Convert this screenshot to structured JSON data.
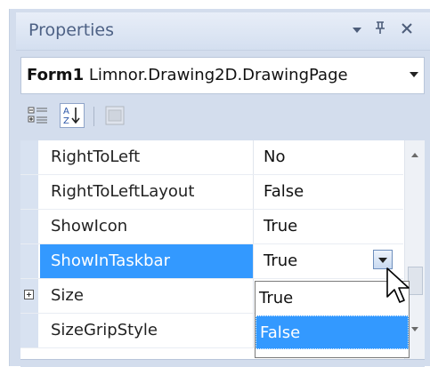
{
  "window": {
    "title": "Properties"
  },
  "selector": {
    "object_name": "Form1",
    "object_type": "Limnor.Drawing2D.DrawingPage"
  },
  "toolbar": {
    "categorized_icon": "categorized-icon",
    "alphabetical_icon": "alphabetical-icon",
    "property_pages_icon": "property-pages-icon"
  },
  "title_buttons": {
    "pin_glyph": "↕",
    "dropdown_glyph": "▾",
    "close_glyph": "✕"
  },
  "properties": [
    {
      "name": "RightToLeft",
      "value": "No"
    },
    {
      "name": "RightToLeftLayout",
      "value": "False"
    },
    {
      "name": "ShowIcon",
      "value": "True"
    },
    {
      "name": "ShowInTaskbar",
      "value": "True",
      "selected": true
    },
    {
      "name": "Size",
      "value": "",
      "expandable": true
    },
    {
      "name": "SizeGripStyle",
      "value": ""
    }
  ],
  "dropdown": {
    "options": [
      "True",
      "False"
    ],
    "highlighted": "False"
  },
  "colors": {
    "selection": "#3399ff",
    "panel": "#d3dded"
  }
}
